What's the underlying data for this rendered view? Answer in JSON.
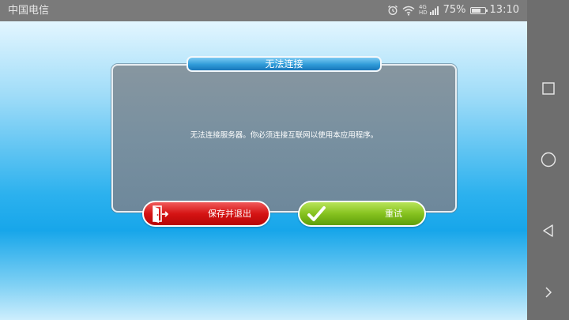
{
  "status_bar": {
    "carrier": "中国电信",
    "signal_label_top": "4G",
    "signal_label_bottom": "HD",
    "battery_percent": "75%",
    "battery_level": 0.75,
    "time": "13:10"
  },
  "dialog": {
    "title": "无法连接",
    "message": "无法连接服务器。你必须连接互联网以使用本应用程序。",
    "exit_button_label": "保存并退出",
    "retry_button_label": "重试"
  },
  "icons": {
    "alarm": "alarm-icon",
    "wifi": "wifi-icon",
    "signal": "signal-icon",
    "battery": "battery-icon",
    "exit": "exit-door-icon",
    "retry": "checkmark-icon",
    "nav_recent": "square-recent-apps-icon",
    "nav_home": "circle-home-icon",
    "nav_back": "triangle-back-icon",
    "nav_expand": "chevron-right-icon"
  },
  "colors": {
    "exit_button": "#d51414",
    "retry_button": "#86c21f",
    "title_bar": "#2f9bd8",
    "dialog_panel": "#7890a0"
  }
}
